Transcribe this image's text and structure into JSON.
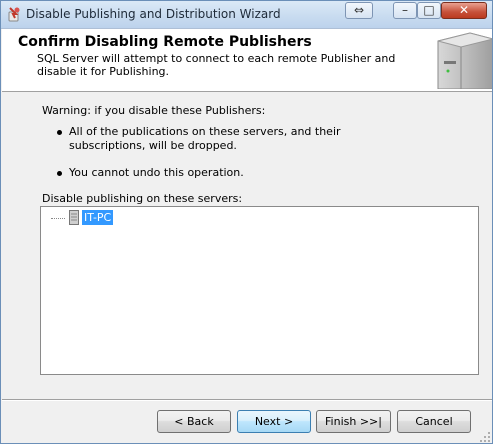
{
  "window": {
    "title": "Disable Publishing and Distribution Wizard",
    "controls": {
      "resize": "⇔",
      "minimize": "–",
      "maximize": "□",
      "close": "✕"
    }
  },
  "header": {
    "title": "Confirm Disabling Remote Publishers",
    "subtitle": "SQL Server will attempt to connect to each remote Publisher and disable it for Publishing."
  },
  "content": {
    "warning": "Warning: if you disable these Publishers:",
    "bullets": [
      "All of the publications on these servers, and their subscriptions, will be dropped.",
      "You cannot undo this operation."
    ],
    "list_label": "Disable publishing on these servers:",
    "servers": [
      {
        "name": "IT-PC",
        "selected": true
      }
    ]
  },
  "buttons": {
    "back": "< Back",
    "next": "Next >",
    "finish": "Finish >>|",
    "cancel": "Cancel"
  },
  "colors": {
    "selection": "#3399ff",
    "titlebar": "#c9dcf0",
    "close_button": "#c6513a"
  }
}
